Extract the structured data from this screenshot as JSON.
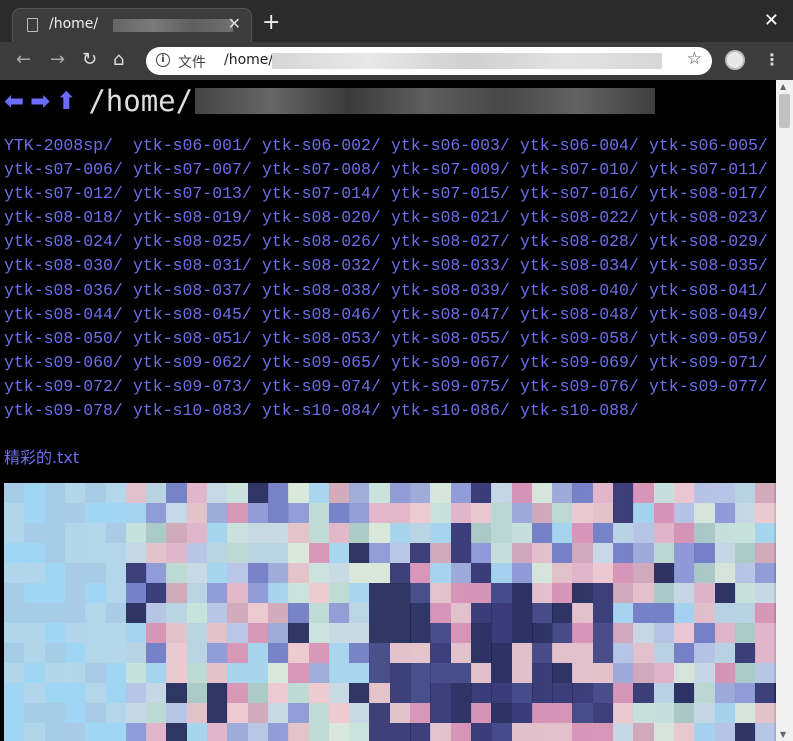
{
  "browser": {
    "tab_title": "/home/",
    "address_label": "文件",
    "address_url": "/home/"
  },
  "page": {
    "path_heading": "/home/",
    "nav_arrows": {
      "back": "⬅",
      "forward": "➡",
      "up": "⬆"
    },
    "directories": [
      "YTK-2008sp/",
      "ytk-s06-001/",
      "ytk-s06-002/",
      "ytk-s06-003/",
      "ytk-s06-004/",
      "ytk-s06-005/",
      "ytk-s07-006/",
      "ytk-s07-007/",
      "ytk-s07-008/",
      "ytk-s07-009/",
      "ytk-s07-010/",
      "ytk-s07-011/",
      "ytk-s07-012/",
      "ytk-s07-013/",
      "ytk-s07-014/",
      "ytk-s07-015/",
      "ytk-s07-016/",
      "ytk-s08-017/",
      "ytk-s08-018/",
      "ytk-s08-019/",
      "ytk-s08-020/",
      "ytk-s08-021/",
      "ytk-s08-022/",
      "ytk-s08-023/",
      "ytk-s08-024/",
      "ytk-s08-025/",
      "ytk-s08-026/",
      "ytk-s08-027/",
      "ytk-s08-028/",
      "ytk-s08-029/",
      "ytk-s08-030/",
      "ytk-s08-031/",
      "ytk-s08-032/",
      "ytk-s08-033/",
      "ytk-s08-034/",
      "ytk-s08-035/",
      "ytk-s08-036/",
      "ytk-s08-037/",
      "ytk-s08-038/",
      "ytk-s08-039/",
      "ytk-s08-040/",
      "ytk-s08-041/",
      "ytk-s08-044/",
      "ytk-s08-045/",
      "ytk-s08-046/",
      "ytk-s08-047/",
      "ytk-s08-048/",
      "ytk-s08-049/",
      "ytk-s08-050/",
      "ytk-s08-051/",
      "ytk-s08-053/",
      "ytk-s08-055/",
      "ytk-s09-058/",
      "ytk-s09-059/",
      "ytk-s09-060/",
      "ytk-s09-062/",
      "ytk-s09-065/",
      "ytk-s09-067/",
      "ytk-s09-069/",
      "ytk-s09-071/",
      "ytk-s09-072/",
      "ytk-s09-073/",
      "ytk-s09-074/",
      "ytk-s09-075/",
      "ytk-s09-076/",
      "ytk-s09-077/",
      "ytk-s09-078/",
      "ytk-s10-083/",
      "ytk-s10-084/",
      "ytk-s10-086/",
      "ytk-s10-088/"
    ],
    "files": [
      "精彩的.txt"
    ]
  },
  "colors": {
    "link": "#6e6ee8",
    "background": "#000000",
    "arrow": "#6c6cff"
  },
  "icons": [
    "file-icon",
    "close-icon",
    "plus-icon",
    "back-icon",
    "forward-icon",
    "reload-icon",
    "home-icon",
    "info-icon",
    "star-icon",
    "profile-icon",
    "menu-icon"
  ]
}
